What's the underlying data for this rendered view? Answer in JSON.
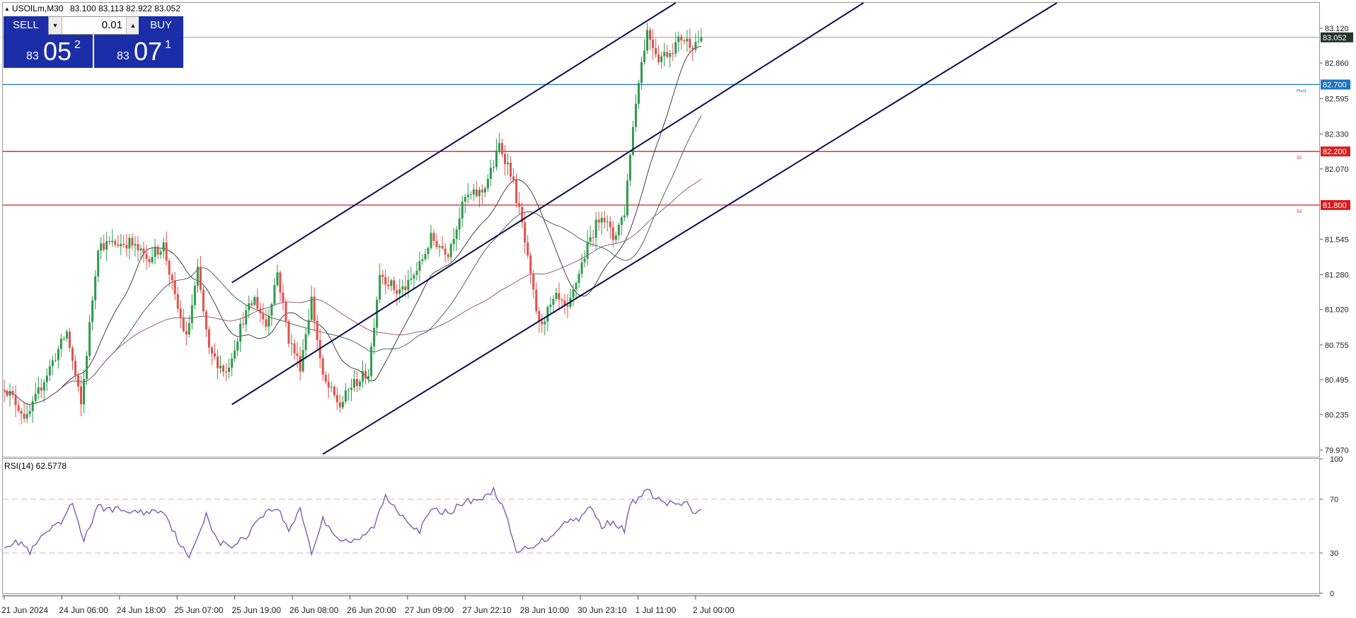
{
  "header": {
    "symbol": "USOILm,M30",
    "ohlc": "83.100 83.113 82.922 83.052"
  },
  "trade_panel": {
    "sell_label": "SELL",
    "buy_label": "BUY",
    "lot": "0.01",
    "sell_prefix": "83",
    "sell_big": "05",
    "sell_sup": "2",
    "buy_prefix": "83",
    "buy_big": "07",
    "buy_sup": "1"
  },
  "colors": {
    "up_candle": "#2e9a4a",
    "down_candle": "#e2504b",
    "channel": "#0a0f4f",
    "pivot_line": "#1e73be",
    "support_line": "#d71f1f",
    "rsi_line": "#7a5fb4",
    "ma_fast": "#3a2a2a",
    "ma_mid": "#2f5f4f",
    "ma_slow": "#8a4a7a"
  },
  "chart_data": [
    {
      "type": "candlestick",
      "symbol": "USOILm",
      "timeframe": "M30",
      "y_ticks": [
        "83.120",
        "82.860",
        "82.595",
        "82.330",
        "82.070",
        "81.545",
        "81.280",
        "81.020",
        "80.755",
        "80.495",
        "80.235",
        "79.970"
      ],
      "ylim": [
        79.92,
        83.31
      ],
      "x_ticks": [
        "21 Jun 2024",
        "24 Jun 06:00",
        "24 Jun 18:00",
        "25 Jun 07:00",
        "25 Jun 19:00",
        "26 Jun 08:00",
        "26 Jun 20:00",
        "27 Jun 09:00",
        "27 Jun 22:10",
        "28 Jun 10:00",
        "30 Jun 23:10",
        "1 Jul 11:00",
        "2 Jul 00:00"
      ],
      "close_path": [
        {
          "i": 0,
          "p": 80.45
        },
        {
          "i": 8,
          "p": 80.2
        },
        {
          "i": 14,
          "p": 80.5
        },
        {
          "i": 22,
          "p": 80.85
        },
        {
          "i": 27,
          "p": 80.3
        },
        {
          "i": 33,
          "p": 81.5
        },
        {
          "i": 44,
          "p": 81.52
        },
        {
          "i": 50,
          "p": 81.4
        },
        {
          "i": 56,
          "p": 81.5
        },
        {
          "i": 60,
          "p": 81.1
        },
        {
          "i": 64,
          "p": 80.8
        },
        {
          "i": 68,
          "p": 81.3
        },
        {
          "i": 72,
          "p": 80.7
        },
        {
          "i": 78,
          "p": 80.55
        },
        {
          "i": 84,
          "p": 80.95
        },
        {
          "i": 88,
          "p": 81.1
        },
        {
          "i": 92,
          "p": 80.9
        },
        {
          "i": 96,
          "p": 81.3
        },
        {
          "i": 100,
          "p": 80.8
        },
        {
          "i": 104,
          "p": 80.6
        },
        {
          "i": 108,
          "p": 81.1
        },
        {
          "i": 112,
          "p": 80.5
        },
        {
          "i": 118,
          "p": 80.3
        },
        {
          "i": 122,
          "p": 80.45
        },
        {
          "i": 128,
          "p": 80.55
        },
        {
          "i": 132,
          "p": 81.3
        },
        {
          "i": 138,
          "p": 81.15
        },
        {
          "i": 142,
          "p": 81.2
        },
        {
          "i": 146,
          "p": 81.35
        },
        {
          "i": 150,
          "p": 81.55
        },
        {
          "i": 156,
          "p": 81.45
        },
        {
          "i": 162,
          "p": 81.85
        },
        {
          "i": 168,
          "p": 81.9
        },
        {
          "i": 172,
          "p": 82.1
        },
        {
          "i": 174,
          "p": 82.25
        },
        {
          "i": 178,
          "p": 82.05
        },
        {
          "i": 182,
          "p": 81.65
        },
        {
          "i": 185,
          "p": 81.25
        },
        {
          "i": 188,
          "p": 80.9
        },
        {
          "i": 194,
          "p": 81.1
        },
        {
          "i": 198,
          "p": 81.0
        },
        {
          "i": 202,
          "p": 81.3
        },
        {
          "i": 206,
          "p": 81.55
        },
        {
          "i": 210,
          "p": 81.75
        },
        {
          "i": 214,
          "p": 81.55
        },
        {
          "i": 218,
          "p": 81.75
        },
        {
          "i": 220,
          "p": 82.2
        },
        {
          "i": 223,
          "p": 82.75
        },
        {
          "i": 226,
          "p": 83.1
        },
        {
          "i": 230,
          "p": 82.9
        },
        {
          "i": 234,
          "p": 82.95
        },
        {
          "i": 238,
          "p": 83.05
        },
        {
          "i": 242,
          "p": 83.0
        },
        {
          "i": 245,
          "p": 83.052
        }
      ],
      "horizontal_levels": [
        {
          "name": "Pivot",
          "value": 82.7
        },
        {
          "name": "S2",
          "value": 82.2
        },
        {
          "name": "S3",
          "value": 81.8
        }
      ],
      "current_price": 83.052,
      "channel_lines": [
        {
          "from": {
            "i": 80,
            "p": 81.22
          },
          "to": {
            "i": 236,
            "p": 83.31
          }
        },
        {
          "from": {
            "i": 80,
            "p": 80.31
          },
          "to": {
            "i": 302,
            "p": 83.31
          }
        },
        {
          "from": {
            "i": 112,
            "p": 79.94
          },
          "to": {
            "i": 370,
            "p": 83.31
          }
        }
      ],
      "grid": false
    },
    {
      "type": "line",
      "title": "RSI(14) 62.5778",
      "y_ticks": [
        "100",
        "70",
        "30",
        "0"
      ],
      "ylim": [
        0,
        100
      ],
      "levels": [
        70,
        30
      ],
      "series": [
        {
          "values": [
            {
              "i": 0,
              "v": 36
            },
            {
              "i": 6,
              "v": 38
            },
            {
              "i": 9,
              "v": 30
            },
            {
              "i": 14,
              "v": 44
            },
            {
              "i": 20,
              "v": 52
            },
            {
              "i": 24,
              "v": 67
            },
            {
              "i": 28,
              "v": 40
            },
            {
              "i": 33,
              "v": 64
            },
            {
              "i": 40,
              "v": 62
            },
            {
              "i": 48,
              "v": 60
            },
            {
              "i": 56,
              "v": 62
            },
            {
              "i": 60,
              "v": 44
            },
            {
              "i": 65,
              "v": 25
            },
            {
              "i": 71,
              "v": 60
            },
            {
              "i": 75,
              "v": 38
            },
            {
              "i": 80,
              "v": 35
            },
            {
              "i": 85,
              "v": 42
            },
            {
              "i": 90,
              "v": 58
            },
            {
              "i": 96,
              "v": 64
            },
            {
              "i": 100,
              "v": 46
            },
            {
              "i": 104,
              "v": 64
            },
            {
              "i": 108,
              "v": 30
            },
            {
              "i": 112,
              "v": 55
            },
            {
              "i": 118,
              "v": 40
            },
            {
              "i": 124,
              "v": 38
            },
            {
              "i": 130,
              "v": 50
            },
            {
              "i": 134,
              "v": 72
            },
            {
              "i": 140,
              "v": 58
            },
            {
              "i": 146,
              "v": 46
            },
            {
              "i": 150,
              "v": 62
            },
            {
              "i": 156,
              "v": 60
            },
            {
              "i": 162,
              "v": 68
            },
            {
              "i": 170,
              "v": 72
            },
            {
              "i": 172,
              "v": 78
            },
            {
              "i": 176,
              "v": 60
            },
            {
              "i": 180,
              "v": 30
            },
            {
              "i": 186,
              "v": 36
            },
            {
              "i": 192,
              "v": 42
            },
            {
              "i": 196,
              "v": 52
            },
            {
              "i": 202,
              "v": 56
            },
            {
              "i": 206,
              "v": 64
            },
            {
              "i": 210,
              "v": 50
            },
            {
              "i": 214,
              "v": 54
            },
            {
              "i": 218,
              "v": 46
            },
            {
              "i": 220,
              "v": 66
            },
            {
              "i": 226,
              "v": 76
            },
            {
              "i": 232,
              "v": 67
            },
            {
              "i": 240,
              "v": 66
            },
            {
              "i": 243,
              "v": 58
            },
            {
              "i": 245,
              "v": 62.58
            }
          ]
        }
      ]
    }
  ]
}
